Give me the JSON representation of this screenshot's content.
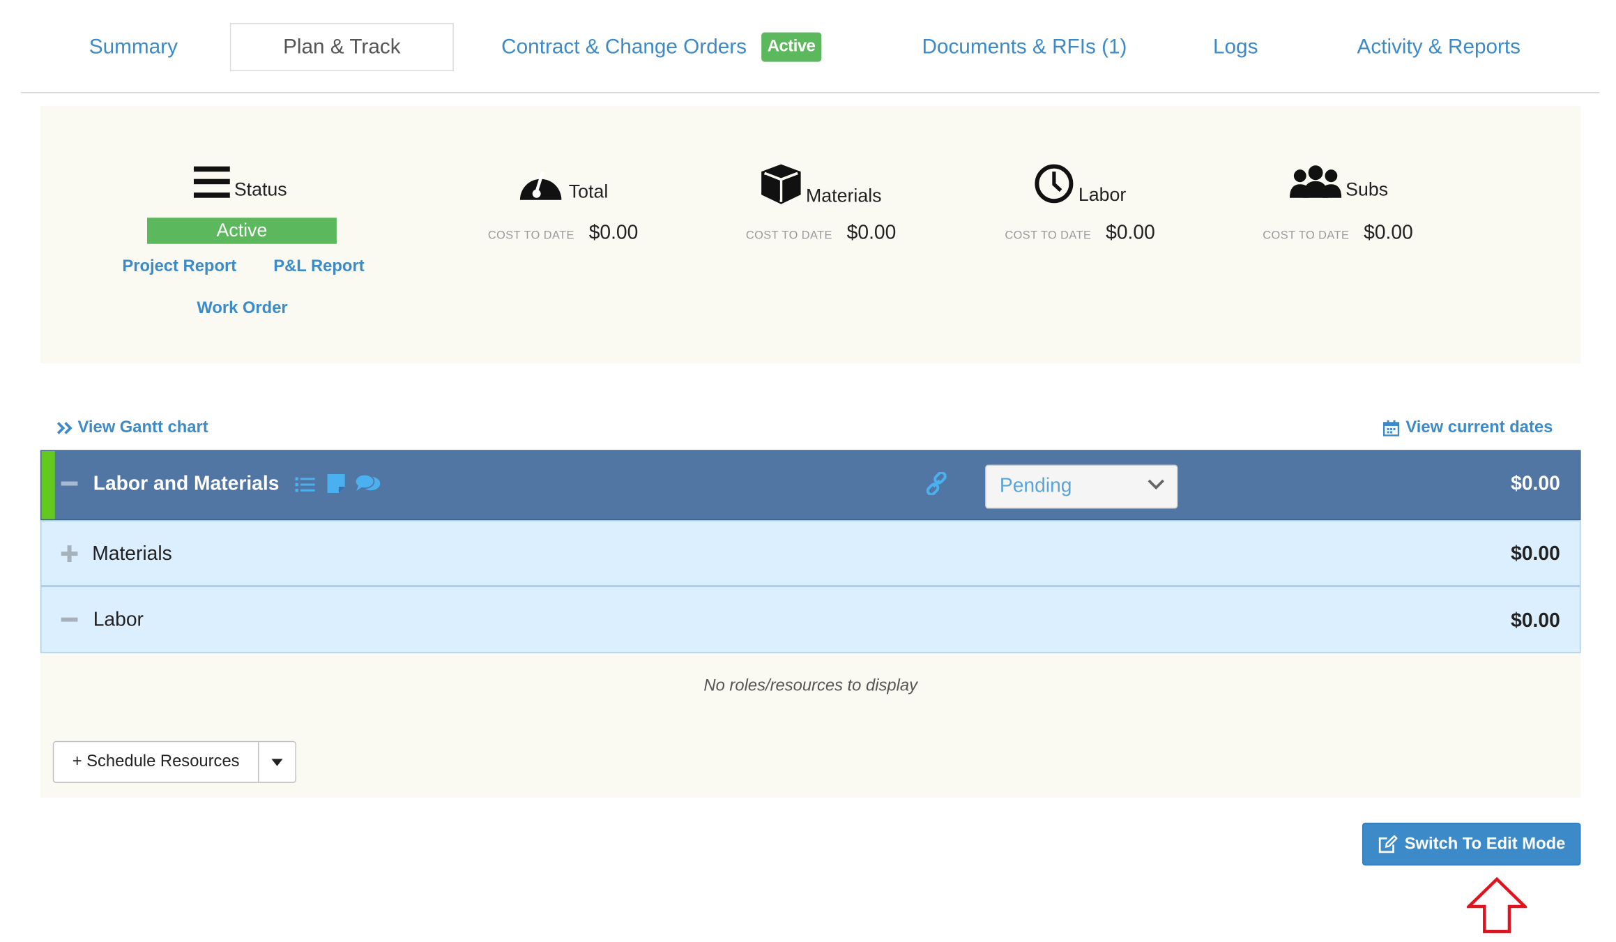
{
  "tabs": [
    {
      "label": "Summary"
    },
    {
      "label": "Plan & Track",
      "active": true
    },
    {
      "label": "Contract & Change Orders",
      "badge": "Active"
    },
    {
      "label": "Documents & RFIs (1)"
    },
    {
      "label": "Logs"
    },
    {
      "label": "Activity & Reports"
    }
  ],
  "summary": {
    "status": {
      "title": "Status",
      "value": "Active",
      "icon": "bars-icon"
    },
    "links": {
      "project_report": "Project Report",
      "pl_report": "P&L Report",
      "work_order": "Work Order"
    },
    "cost_label": "COST TO DATE",
    "costs": [
      {
        "title": "Total",
        "value": "$0.00",
        "icon": "gauge-icon"
      },
      {
        "title": "Materials",
        "value": "$0.00",
        "icon": "cube-icon"
      },
      {
        "title": "Labor",
        "value": "$0.00",
        "icon": "clock-icon"
      },
      {
        "title": "Subs",
        "value": "$0.00",
        "icon": "users-icon"
      }
    ]
  },
  "gantt_link": "View Gantt chart",
  "dates_link": "View current dates",
  "phase": {
    "name": "Labor and Materials",
    "status": "Pending",
    "amount": "$0.00",
    "icons": [
      "list-icon",
      "note-icon",
      "comments-icon",
      "link-icon"
    ]
  },
  "sub_rows": [
    {
      "label": "Materials",
      "amount": "$0.00",
      "toggle": "plus"
    },
    {
      "label": "Labor",
      "amount": "$0.00",
      "toggle": "minus"
    }
  ],
  "empty_message": "No roles/resources to display",
  "schedule_button": "+ Schedule Resources",
  "edit_button": "Switch To Edit Mode",
  "colors": {
    "accent": "#3d8ac9",
    "active_green": "#5cb85c",
    "phase_row": "#5276a4",
    "phase_bar": "#63c91f",
    "sub_row": "#dcefff",
    "panel_bg": "#fafaf2",
    "annotation_arrow": "#e0141e"
  }
}
